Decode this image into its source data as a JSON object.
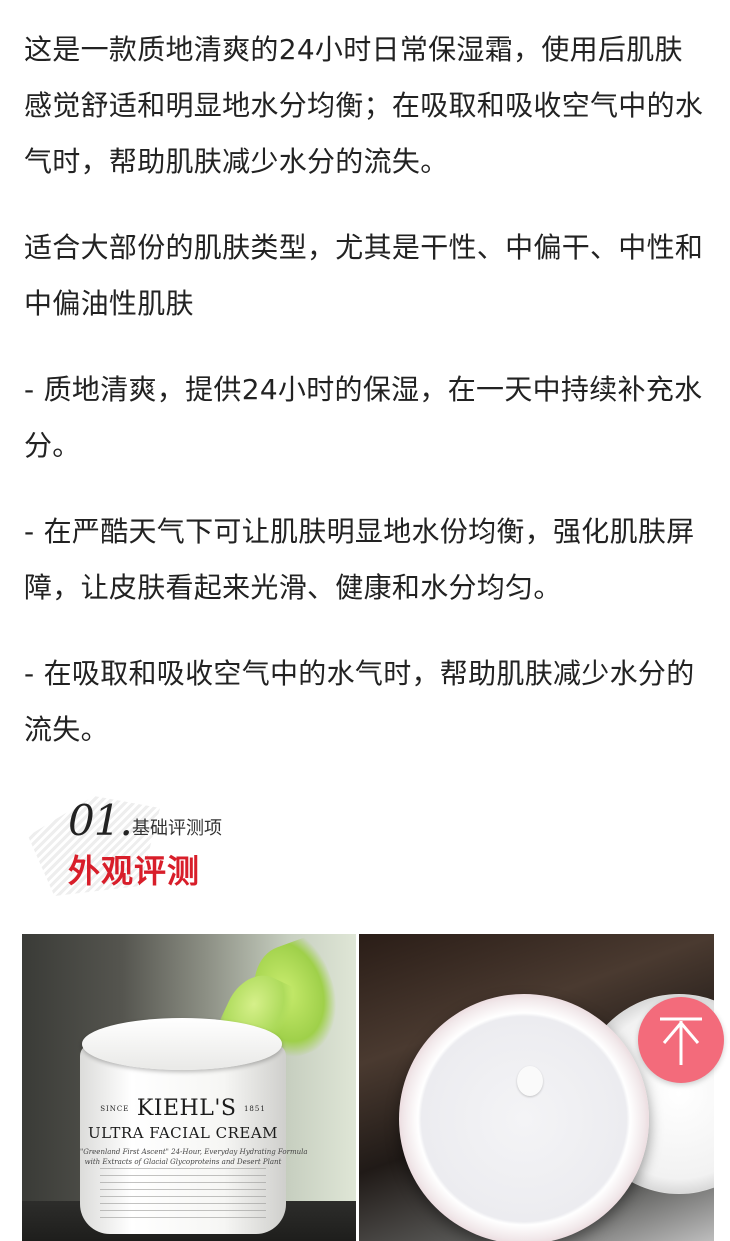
{
  "article": {
    "paragraphs": [
      "这是一款质地清爽的24小时日常保湿霜，使用后肌肤感觉舒适和明显地水分均衡；在吸取和吸收空气中的水气时，帮助肌肤减少水分的流失。",
      "适合大部份的肌肤类型，尤其是干性、中偏干、中性和中偏油性肌肤",
      "- 质地清爽，提供24小时的保湿，在一天中持续补充水分。",
      "- 在严酷天气下可让肌肤明显地水份均衡，强化肌肤屏障，让皮肤看起来光滑、健康和水分均匀。",
      "- 在吸取和吸收空气中的水气时，帮助肌肤减少水分的流失。"
    ]
  },
  "section": {
    "number": "01.",
    "subtitle": "基础评测项",
    "title": "外观评测",
    "title_color": "#d81e2a"
  },
  "photos": {
    "left_label": {
      "since": "SINCE",
      "brand": "KIEHL'S",
      "year": "1851",
      "product": "ULTRA FACIAL CREAM",
      "desc_line1": "\"Greenland First Ascent\" 24-Hour, Everyday Hydrating Formula",
      "desc_line2": "with Extracts of Glacial Glycoproteins and Desert Plant"
    }
  },
  "back_to_top": {
    "icon": "arrow-up-icon",
    "color": "#f36b7b"
  }
}
